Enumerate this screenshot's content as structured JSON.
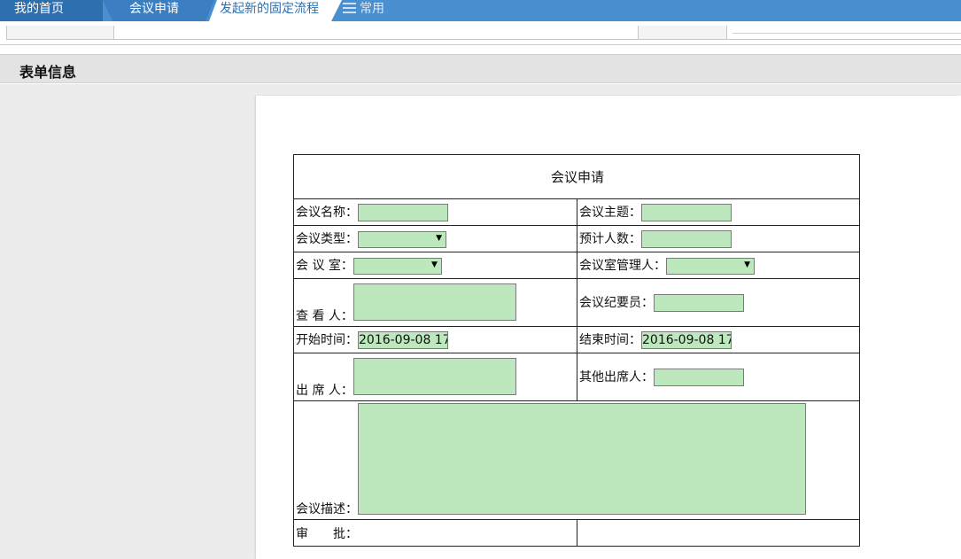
{
  "tabs": {
    "home": "我的首页",
    "meeting_apply": "会议申请",
    "active": "发起新的固定流程",
    "common": "常用"
  },
  "section": {
    "title": "表单信息"
  },
  "form": {
    "title": "会议申请",
    "meeting_name_label": "会议名称：",
    "meeting_topic_label": "会议主题：",
    "meeting_type_label": "会议类型：",
    "expected_count_label": "预计人数：",
    "meeting_room_label": "会 议 室：",
    "room_manager_label": "会议室管理人：",
    "viewer_label": "查 看 人：",
    "recorder_label": "会议纪要员：",
    "start_time_label": "开始时间：",
    "start_time_value": "2016-09-08 17",
    "end_time_label": "结束时间：",
    "end_time_value": "2016-09-08 17",
    "attendee_label": "出 席 人：",
    "other_attendee_label": "其他出席人：",
    "description_label": "会议描述：",
    "approval_label": "审　　批："
  },
  "colors": {
    "tab_bar": "#4a8fcf",
    "field_fill": "#bde8bd",
    "section_bg": "#e3e3e3"
  }
}
